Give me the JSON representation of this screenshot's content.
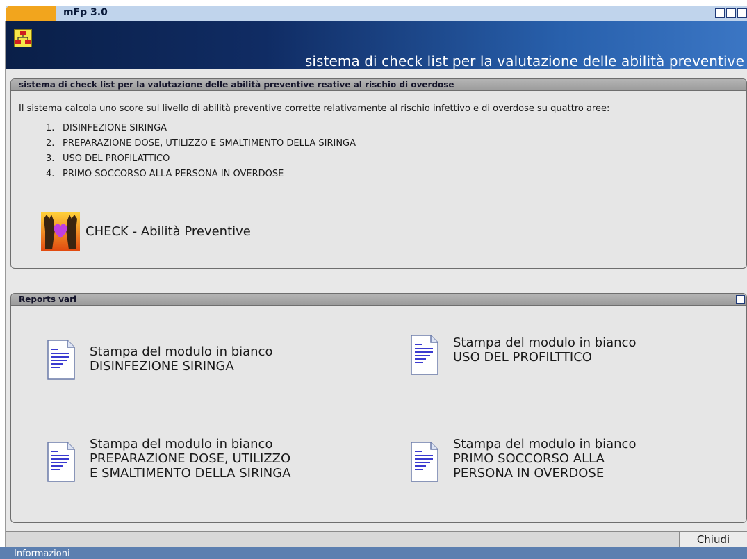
{
  "window": {
    "title": "mFp 3.0",
    "accent_color": "#f2a51d"
  },
  "header": {
    "subtitle": "sistema di check list per la valutazione delle abilità preventive",
    "app_icon": "org-chart-icon"
  },
  "checklist_panel": {
    "title": "sistema di check list per la valutazione delle abilità preventive reative al rischio di overdose",
    "intro": "Il sistema calcola uno score sul livello di abilità preventive corrette relativamente al rischio infettivo e di overdose su quattro aree:",
    "areas": [
      {
        "num": "1.",
        "label": "DISINFEZIONE SIRINGA"
      },
      {
        "num": "2.",
        "label": "PREPARAZIONE DOSE, UTILIZZO E SMALTIMENTO DELLA SIRINGA"
      },
      {
        "num": "3.",
        "label": "USO DEL PROFILATTICO"
      },
      {
        "num": "4.",
        "label": "PRIMO SOCCORSO ALLA PERSONA IN OVERDOSE"
      }
    ],
    "check_link": {
      "label": "CHECK - Abilità Preventive",
      "icon": "hands-heart-icon"
    }
  },
  "reports_panel": {
    "title": "Reports vari",
    "reports": [
      {
        "lines": [
          "Stampa del modulo in bianco",
          "DISINFEZIONE SIRINGA"
        ]
      },
      {
        "lines": [
          "Stampa del modulo in bianco",
          "USO DEL PROFILTTICO"
        ]
      },
      {
        "lines": [
          "Stampa del modulo in bianco",
          "PREPARAZIONE DOSE, UTILIZZO",
          "E SMALTIMENTO DELLA SIRINGA"
        ]
      },
      {
        "lines": [
          "Stampa del modulo in bianco",
          "PRIMO SOCCORSO ALLA",
          "PERSONA IN OVERDOSE"
        ]
      }
    ]
  },
  "footer": {
    "close_label": "Chiudi",
    "status_text": "Informazioni"
  }
}
